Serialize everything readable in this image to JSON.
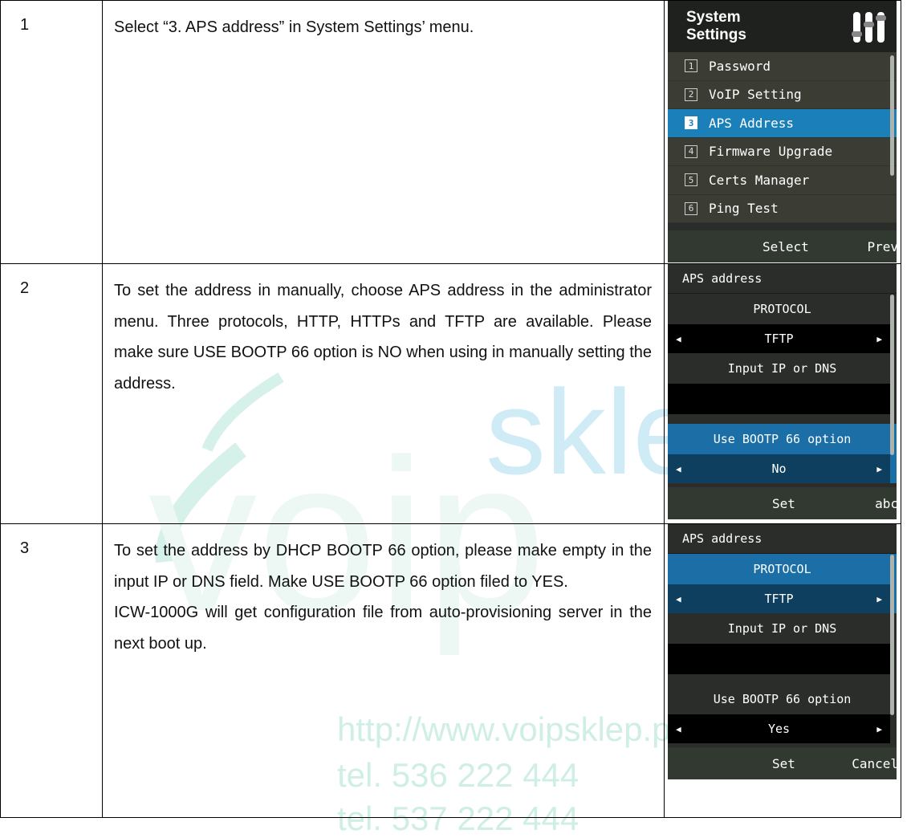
{
  "watermark": {
    "url": "http://www.voipsklep.pl",
    "tel1": "tel. 536 222 444",
    "tel2": "tel. 537 222 444",
    "brand_left": "voip",
    "brand_right": "sklep"
  },
  "rows": [
    {
      "step": "1",
      "text": [
        "Select “3. APS address” in System Settings’ menu."
      ],
      "screen": {
        "title": "System\nSettings",
        "menu": [
          {
            "num": "1",
            "label": "Password"
          },
          {
            "num": "2",
            "label": "VoIP Setting"
          },
          {
            "num": "3",
            "label": "APS Address",
            "selected": true
          },
          {
            "num": "4",
            "label": "Firmware Upgrade"
          },
          {
            "num": "5",
            "label": "Certs Manager"
          },
          {
            "num": "6",
            "label": "Ping Test"
          }
        ],
        "softkey_left": "Select",
        "softkey_right": "Prev"
      }
    },
    {
      "step": "2",
      "text": [
        "To set the address in manually, choose APS address in the administrator menu. Three protocols, HTTP, HTTPs and TFTP are available. Please make sure USE BOOTP 66 option is NO when using in manually setting the address."
      ],
      "screen": {
        "title": "APS address",
        "protocol_label": "PROTOCOL",
        "protocol_value": "TFTP",
        "input_label": "Input IP or DNS",
        "input_value": "",
        "bootp_label": "Use BOOTP 66 option",
        "bootp_value": "No",
        "softkey_left": "Set",
        "softkey_right": "abc"
      }
    },
    {
      "step": "3",
      "text": [
        "To set the address by DHCP BOOTP  66 option, please make empty in the input IP or DNS field. Make USE BOOTP 66 option filed to YES.",
        "ICW-1000G will get configuration file from auto-provisioning server in the next boot up."
      ],
      "screen": {
        "title": "APS address",
        "protocol_label": "PROTOCOL",
        "protocol_value": "TFTP",
        "input_label": "Input IP or DNS",
        "input_value": "",
        "bootp_label": "Use BOOTP 66 option",
        "bootp_value": "Yes",
        "softkey_left": "Set",
        "softkey_right": "Cancel"
      }
    }
  ]
}
